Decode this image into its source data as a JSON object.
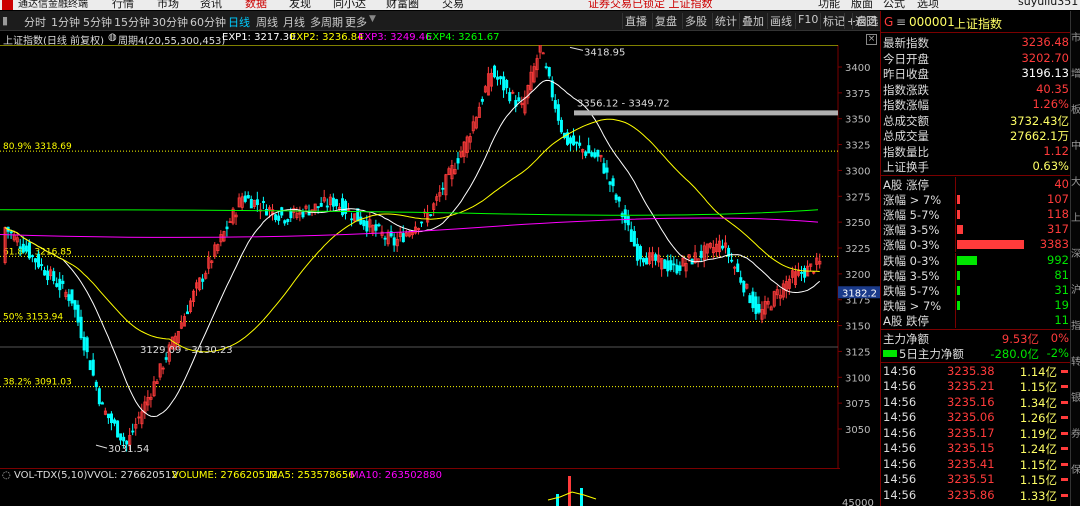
{
  "menubar": {
    "app_title": "通达信金融终端",
    "items": [
      "行情",
      "市场",
      "资讯",
      "数据",
      "发现",
      "同小达",
      "财富圈",
      "交易"
    ],
    "notice": "证券交易已锁定  上证指数",
    "right_items": [
      "功能",
      "版面",
      "公式",
      "选项"
    ],
    "user": "suyuliu351"
  },
  "periods": [
    "分时",
    "1分钟",
    "5分钟",
    "15分钟",
    "30分钟",
    "60分钟",
    "日线",
    "周线",
    "月线",
    "多周期",
    "更多"
  ],
  "active_period": "日线",
  "toolbar": [
    "直播",
    "复盘",
    "多股",
    "统计",
    "叠加",
    "画线",
    "F10",
    "标记",
    "+自选",
    "返回"
  ],
  "chart_info": {
    "name": "上证指数(日线 前复权)",
    "period_label": "周期4(20,55,300,453)",
    "exp1": "EXP1: 3217.30",
    "exp2": "EXP2: 3236.84",
    "exp3": "EXP3: 3249.46",
    "exp4": "EXP4: 3261.67"
  },
  "annotations": {
    "high": "3418.95",
    "low": "3031.54",
    "range1": "3356.12 - 3349.72",
    "range2": "3129.09 - 3130.23",
    "fib_809": "80.9% 3318.69",
    "fib_618": "61.8% 3216.85",
    "fib_50": "50% 3153.94",
    "fib_382": "38.2% 3091.03",
    "current_marker": "3182.2"
  },
  "y_ticks": [
    "3400",
    "3375",
    "3350",
    "3325",
    "3300",
    "3275",
    "3250",
    "3225",
    "3200",
    "3175",
    "3150",
    "3125",
    "3100",
    "3075",
    "3050"
  ],
  "vol_info": {
    "name": "VOL-TDX(5,10)",
    "vvol": "VVOL: 276620512",
    "volume": "VOLUME: 276620512",
    "ma5": "MA5: 253578656",
    "ma10": "MA10: 263502880",
    "axis_label": "45000"
  },
  "quote": {
    "badge": "G",
    "code": "000001",
    "name": "上证指数",
    "rows": [
      {
        "label": "最新指数",
        "value": "3236.48",
        "color": "#ff3b3b"
      },
      {
        "label": "今日开盘",
        "value": "3202.70",
        "color": "#ff3b3b"
      },
      {
        "label": "昨日收盘",
        "value": "3196.13",
        "color": "#ffffff"
      },
      {
        "label": "指数涨跌",
        "value": "40.35",
        "color": "#ff3b3b"
      },
      {
        "label": "指数涨幅",
        "value": "1.26%",
        "color": "#ff3b3b"
      },
      {
        "label": "总成交额",
        "value": "3732.43亿",
        "color": "#ffff66"
      },
      {
        "label": "总成交量",
        "value": "27662.1万",
        "color": "#ffff66"
      },
      {
        "label": "指数量比",
        "value": "1.12",
        "color": "#ff3b3b"
      },
      {
        "label": "上证换手",
        "value": "0.63%",
        "color": "#ffff66"
      }
    ],
    "breadth": [
      {
        "label": "A股 涨停",
        "value": "40",
        "color": "#ff3b3b",
        "bar": 0
      },
      {
        "label": "涨幅 > 7%",
        "value": "107",
        "color": "#ff3b3b",
        "bar": 0.018
      },
      {
        "label": "涨幅 5-7%",
        "value": "118",
        "color": "#ff3b3b",
        "bar": 0.02
      },
      {
        "label": "涨幅 3-5%",
        "value": "317",
        "color": "#ff3b3b",
        "bar": 0.054
      },
      {
        "label": "涨幅 0-3%",
        "value": "3383",
        "color": "#ff3b3b",
        "bar": 0.58
      },
      {
        "label": "跌幅 0-3%",
        "value": "992",
        "color": "#00e600",
        "bar": 0.17
      },
      {
        "label": "跌幅 3-5%",
        "value": "81",
        "color": "#00e600",
        "bar": 0.014
      },
      {
        "label": "跌幅 5-7%",
        "value": "31",
        "color": "#00e600",
        "bar": 0.005
      },
      {
        "label": "跌幅 > 7%",
        "value": "19",
        "color": "#00e600",
        "bar": 0.003
      },
      {
        "label": "A股 跌停",
        "value": "11",
        "color": "#00e600",
        "bar": 0
      }
    ],
    "flow": [
      {
        "label": "主力净额",
        "value": "9.53亿",
        "pct": "0%"
      },
      {
        "label": "5日主力净额",
        "value": "-280.0亿",
        "pct": "-2%"
      }
    ],
    "ticks": [
      {
        "time": "14:56",
        "price": "3235.38",
        "amount": "1.14亿"
      },
      {
        "time": "14:56",
        "price": "3235.21",
        "amount": "1.15亿"
      },
      {
        "time": "14:56",
        "price": "3235.16",
        "amount": "1.34亿"
      },
      {
        "time": "14:56",
        "price": "3235.06",
        "amount": "1.26亿"
      },
      {
        "time": "14:56",
        "price": "3235.17",
        "amount": "1.19亿"
      },
      {
        "time": "14:56",
        "price": "3235.15",
        "amount": "1.24亿"
      },
      {
        "time": "14:56",
        "price": "3235.41",
        "amount": "1.15亿"
      },
      {
        "time": "14:56",
        "price": "3235.51",
        "amount": "1.15亿"
      },
      {
        "time": "14:56",
        "price": "3235.86",
        "amount": "1.33亿"
      }
    ]
  },
  "edge_labels": [
    "市",
    "增",
    "板",
    "中",
    "大",
    "上",
    "深",
    "沪",
    "指",
    "转",
    "银",
    "券",
    "保"
  ],
  "colors": {
    "up": "#ff3b3b",
    "down": "#00ffff",
    "ma1": "#ffffff",
    "ma2": "#ffff00",
    "ma3": "#ff00ff",
    "ma4": "#00ff00",
    "fib": "#ffff00",
    "border": "#7a0000",
    "accent": "#00ccff"
  }
}
